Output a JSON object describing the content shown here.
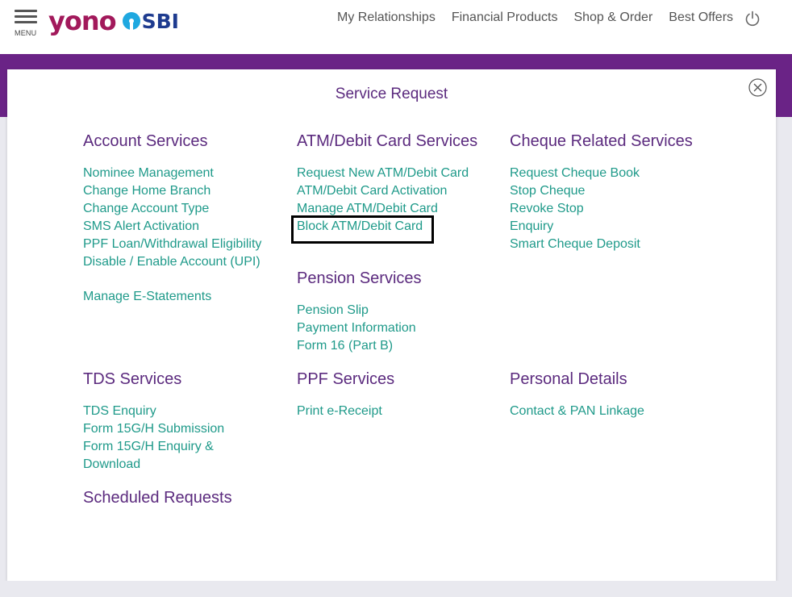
{
  "header": {
    "menu_label": "MENU",
    "logo_primary": "yono",
    "logo_secondary": "SBI",
    "nav": [
      "My Relationships",
      "Financial Products",
      "Shop & Order",
      "Best Offers"
    ]
  },
  "modal": {
    "title": "Service Request",
    "sections": {
      "account": {
        "title": "Account Services",
        "items": [
          "Nominee Management",
          "Change Home Branch",
          "Change Account Type",
          "SMS Alert Activation",
          "PPF Loan/Withdrawal Eligibility",
          "Disable / Enable Account (UPI)",
          "Manage E-Statements"
        ]
      },
      "atm": {
        "title": "ATM/Debit Card Services",
        "items": [
          "Request New ATM/Debit Card",
          "ATM/Debit Card Activation",
          "Manage ATM/Debit Card",
          "Block ATM/Debit Card"
        ]
      },
      "cheque": {
        "title": "Cheque Related Services",
        "items": [
          "Request Cheque Book",
          "Stop Cheque",
          "Revoke Stop",
          "Enquiry",
          "Smart Cheque Deposit"
        ]
      },
      "pension": {
        "title": "Pension Services",
        "items": [
          "Pension Slip",
          "Payment Information",
          "Form 16 (Part B)"
        ]
      },
      "tds": {
        "title": "TDS Services",
        "items": [
          "TDS Enquiry",
          "Form 15G/H Submission",
          "Form 15G/H Enquiry &",
          "Download"
        ]
      },
      "ppf": {
        "title": "PPF Services",
        "items": [
          "Print e-Receipt"
        ]
      },
      "personal": {
        "title": "Personal Details",
        "items": [
          "Contact & PAN Linkage"
        ]
      },
      "scheduled": {
        "title": "Scheduled Requests"
      }
    }
  },
  "colors": {
    "brand_purple": "#6a2386",
    "heading_purple": "#5b2a7e",
    "link_teal": "#1f9a8a",
    "logo_magenta": "#a2195b",
    "logo_blue": "#1e3b8f",
    "sbi_mark": "#1fa8e0"
  }
}
